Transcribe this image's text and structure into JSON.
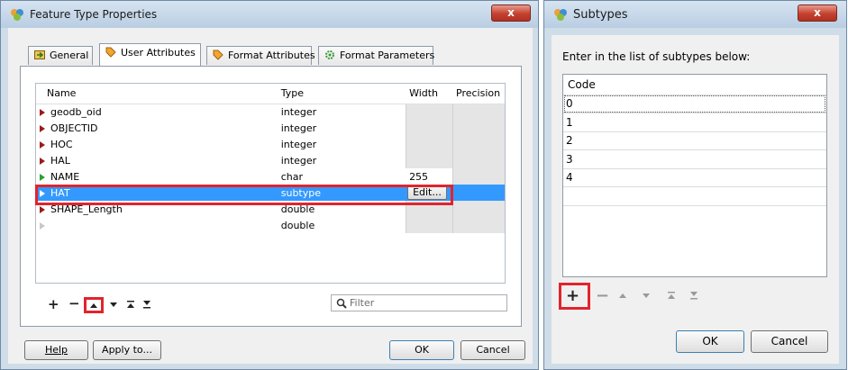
{
  "left_dialog": {
    "title": "Feature Type Properties",
    "close_label": "x",
    "tabs": [
      {
        "label": "General",
        "icon": "general-tab-icon",
        "active": false
      },
      {
        "label": "User Attributes",
        "icon": "attribute-tab-icon",
        "active": true
      },
      {
        "label": "Format Attributes",
        "icon": "attribute-tab-icon",
        "active": false
      },
      {
        "label": "Format Parameters",
        "icon": "gear-tab-icon",
        "active": false
      }
    ],
    "table": {
      "headers": {
        "name": "Name",
        "type": "Type",
        "width": "Width",
        "precision": "Precision"
      },
      "rows": [
        {
          "name": "geodb_oid",
          "type": "integer",
          "width": "",
          "precision": "",
          "marker": "red"
        },
        {
          "name": "OBJECTID",
          "type": "integer",
          "width": "",
          "precision": "",
          "marker": "red"
        },
        {
          "name": "HOC",
          "type": "integer",
          "width": "",
          "precision": "",
          "marker": "red"
        },
        {
          "name": "HAL",
          "type": "integer",
          "width": "",
          "precision": "",
          "marker": "red"
        },
        {
          "name": "NAME",
          "type": "char",
          "width": "255",
          "precision": "",
          "marker": "green"
        },
        {
          "name": "HAT",
          "type": "subtype",
          "width": "Edit...",
          "precision": "",
          "marker": "white",
          "selected": true
        },
        {
          "name": "SHAPE_Length",
          "type": "double",
          "width": "",
          "precision": "",
          "marker": "red"
        },
        {
          "name": "",
          "type": "double",
          "width": "",
          "precision": "",
          "marker": "pale"
        }
      ]
    },
    "filter_placeholder": "Filter",
    "buttons": {
      "help": "Help",
      "apply_to": "Apply to...",
      "ok": "OK",
      "cancel": "Cancel"
    },
    "accent_color": "#3399ff",
    "highlight_color": "#e1242c"
  },
  "right_dialog": {
    "title": "Subtypes",
    "close_label": "x",
    "prompt": "Enter in the list of subtypes below:",
    "column_header": "Code",
    "codes": [
      "0",
      "1",
      "2",
      "3",
      "4",
      ""
    ],
    "buttons": {
      "ok": "OK",
      "cancel": "Cancel"
    }
  }
}
